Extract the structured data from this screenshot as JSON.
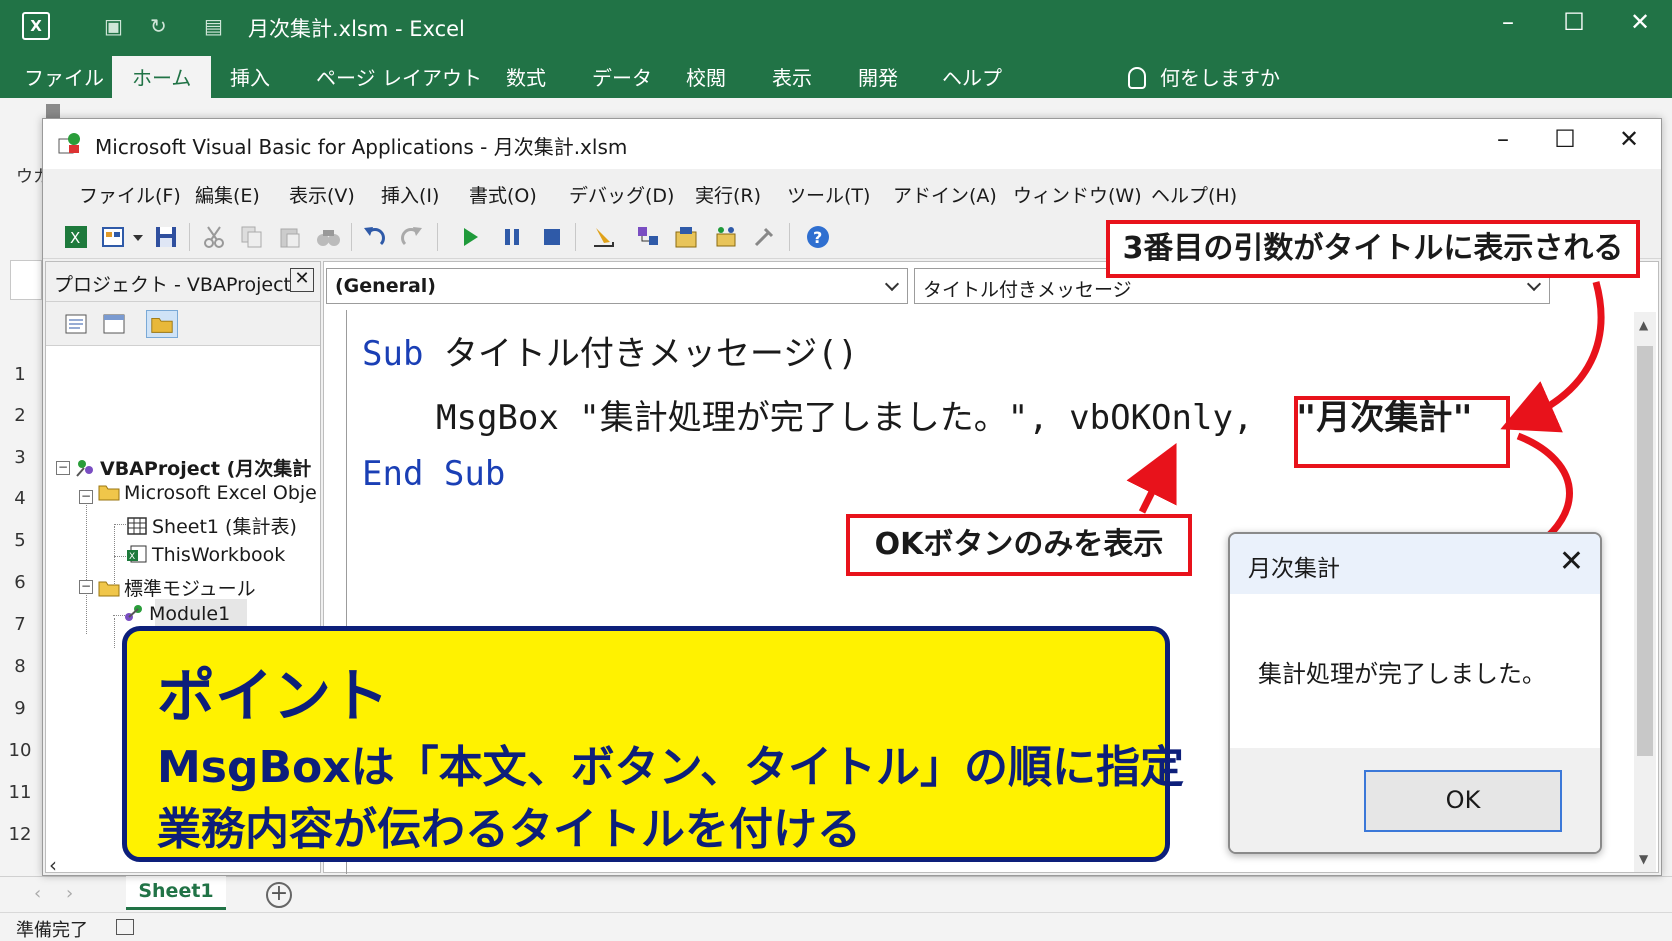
{
  "excel": {
    "title": "月次集計.xlsm  -  Excel",
    "tabs": [
      "ファイル",
      "ホーム",
      "挿入",
      "ページ レイアウト",
      "数式",
      "データ",
      "校閲",
      "表示",
      "開発",
      "ヘルプ"
    ],
    "active_tab": "ホーム",
    "tell_me": "何をしますか",
    "row_numbers": [
      "1",
      "2",
      "3",
      "4",
      "5",
      "6",
      "7",
      "8",
      "9",
      "10",
      "11",
      "12"
    ],
    "sheet_tab": "Sheet1",
    "status": "準備完了",
    "clipped_label": "ウカ"
  },
  "vbe": {
    "title": "Microsoft Visual Basic for Applications - 月次集計.xlsm",
    "menu": [
      "ファイル(F)",
      "編集(E)",
      "表示(V)",
      "挿入(I)",
      "書式(O)",
      "デバッグ(D)",
      "実行(R)",
      "ツール(T)",
      "アドイン(A)",
      "ウィンドウ(W)",
      "ヘルプ(H)"
    ],
    "project_title": "プロジェクト - VBAProject",
    "tree": {
      "root": "VBAProject (月次集計",
      "excel_objects": "Microsoft Excel Obje",
      "sheet1": "Sheet1 (集計表)",
      "workbook": "ThisWorkbook",
      "modules": "標準モジュール",
      "module1": "Module1"
    },
    "object_combo": "(General)",
    "proc_combo": "タイトル付きメッセージ",
    "code": {
      "line1_kw": "Sub",
      "line1_rest": " タイトル付きメッセージ()",
      "line2_a": "MsgBox \"集計処理が完了しました。\", vbOKOnly, ",
      "line2_b": "\"月次集計\"",
      "line3_kw": "End Sub"
    }
  },
  "annotations": {
    "title_arg": "3番目の引数がタイトルに表示される",
    "ok_only": "OKボタンのみを表示",
    "point_head": "ポイント",
    "point_line1": "MsgBoxは「本文、ボタン、タイトル」の順に指定",
    "point_line2": "業務内容が伝わるタイトルを付ける"
  },
  "dialog": {
    "title": "月次集計",
    "message": "集計処理が完了しました。",
    "ok": "OK"
  },
  "colors": {
    "excel_green": "#217346",
    "annotation_red": "#e8121b",
    "point_yellow": "#fff200",
    "point_navy": "#0d1f7a",
    "keyword_blue": "#1a3fb5"
  }
}
